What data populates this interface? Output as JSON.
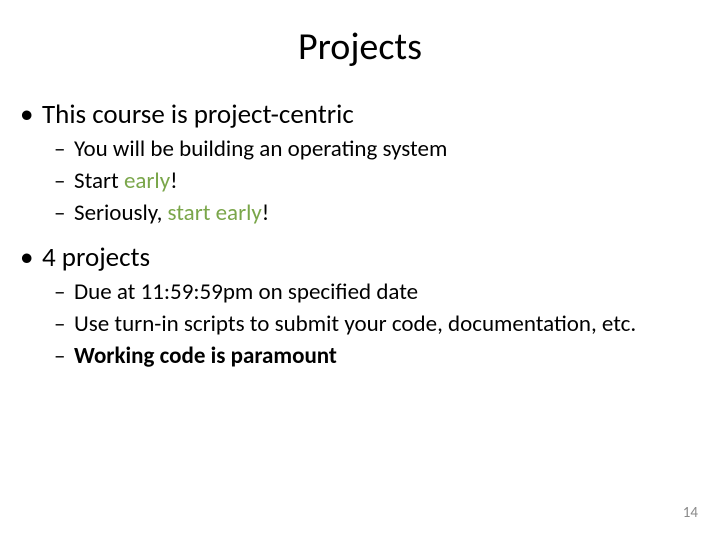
{
  "title": "Projects",
  "b1": {
    "text": "This course is project-centric"
  },
  "b1s": {
    "a": "You will be building an operating system",
    "b_prefix": "Start ",
    "b_em": "early",
    "b_suffix": "!",
    "c_prefix": "Seriously, ",
    "c_em": "start early",
    "c_suffix": "!"
  },
  "b2": {
    "text": "4 projects"
  },
  "b2s": {
    "a": "Due at 11:59:59pm on specified date",
    "b": "Use turn-in scripts to submit your code, documentation, etc.",
    "c": "Working code is paramount"
  },
  "page_number": "14",
  "glyphs": {
    "dot": "•",
    "dash": "–"
  }
}
